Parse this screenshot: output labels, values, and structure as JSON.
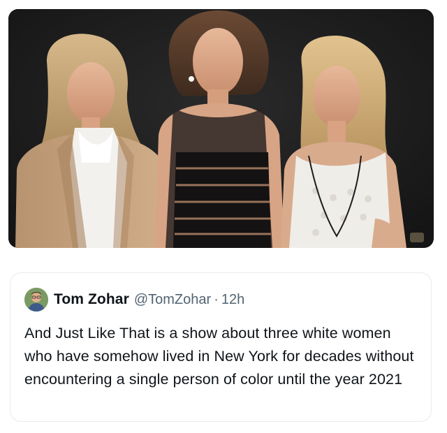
{
  "photo": {
    "icon": "group-photo-image"
  },
  "tweet": {
    "display_name": "Tom Zohar",
    "handle": "@TomZohar",
    "separator": "·",
    "time": "12h",
    "text": "And Just Like That is a show about three white women who have somehow lived in New York for decades without encountering a single person of color until the year 2021"
  },
  "colors": {
    "text_primary": "#0f1419",
    "text_secondary": "#536471",
    "card_border": "#e7ebee",
    "photo_background": "#1e1e1f"
  }
}
